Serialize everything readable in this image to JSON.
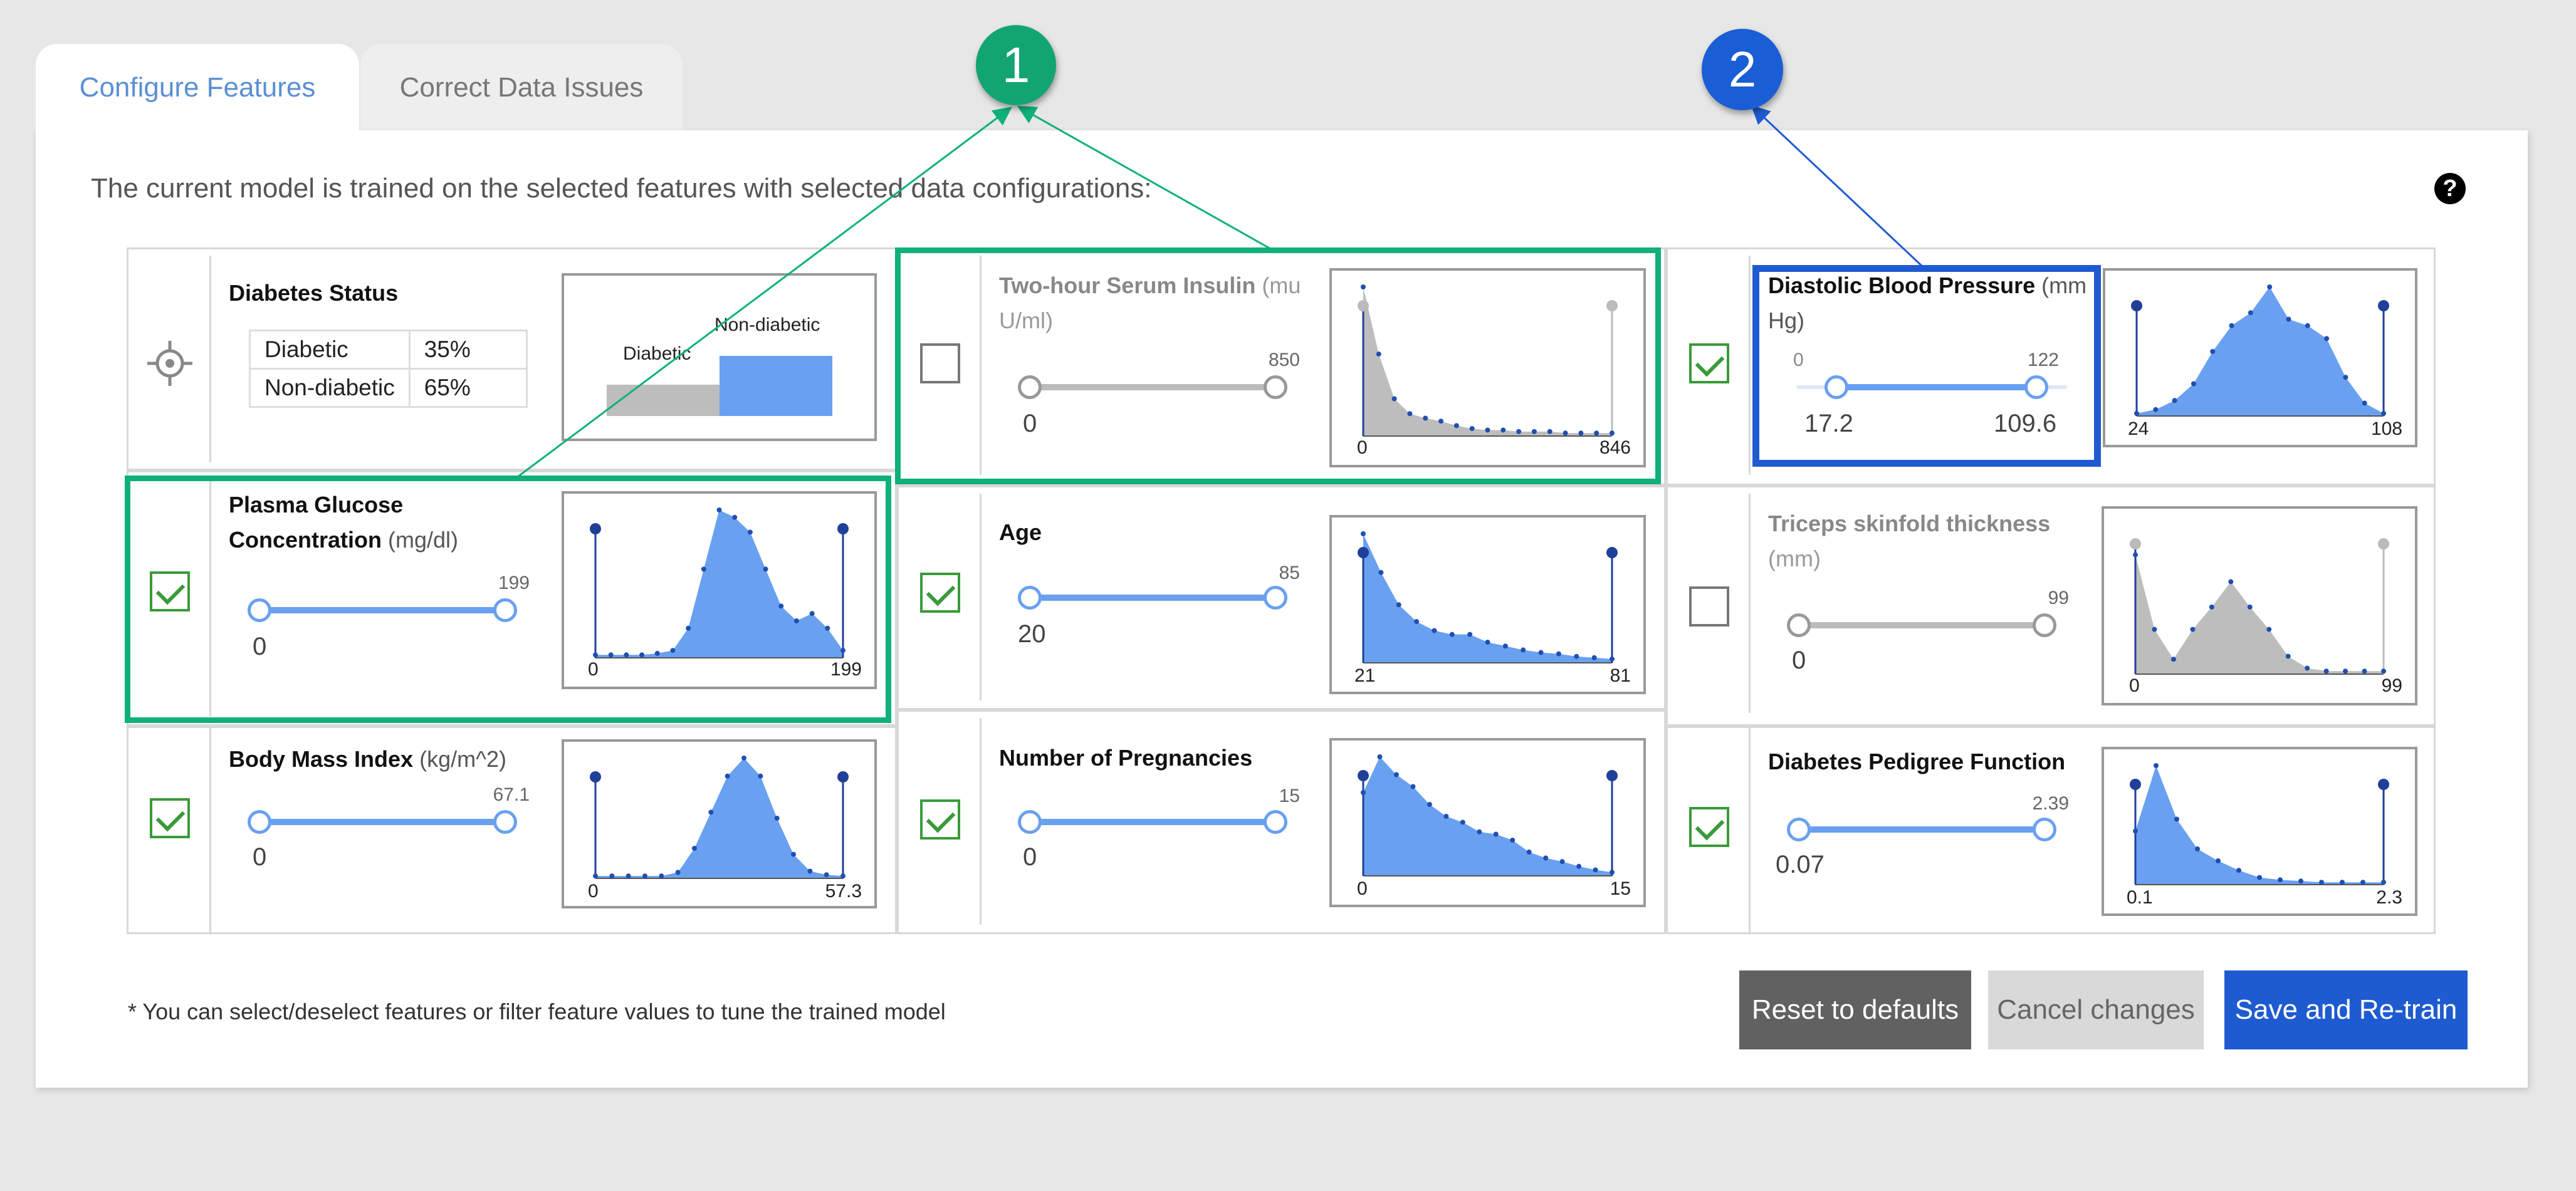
{
  "tabs": [
    {
      "label": "Configure Features",
      "active": true
    },
    {
      "label": "Correct Data Issues",
      "active": false
    }
  ],
  "intro": "The current model is trained on the selected features with selected data configurations:",
  "help_icon": "?",
  "target": {
    "title": "Diabetes Status",
    "rows": [
      {
        "label": "Diabetic",
        "value": "35%"
      },
      {
        "label": "Non-diabetic",
        "value": "65%"
      }
    ],
    "chart_labels": {
      "diabetic": "Diabetic",
      "non_diabetic": "Non-diabetic"
    },
    "shares": {
      "diabetic": 0.35,
      "non_diabetic": 0.65
    }
  },
  "features": {
    "insulin": {
      "name": "Two-hour Serum Insulin",
      "unit": "(mu U/ml)",
      "checked": false,
      "min": "0",
      "max": "850",
      "axis_min": "0",
      "axis_max": "846"
    },
    "bp": {
      "name": "Diastolic Blood Pressure",
      "unit": "(mm Hg)",
      "checked": true,
      "range_min": "0",
      "range_max": "122",
      "min": "17.2",
      "max": "109.6",
      "axis_min": "24",
      "axis_max": "108"
    },
    "glucose": {
      "name": "Plasma Glucose Concentration",
      "unit": "(mg/dl)",
      "checked": true,
      "min": "0",
      "max": "199",
      "axis_min": "0",
      "axis_max": "199"
    },
    "age": {
      "name": "Age",
      "unit": "",
      "checked": true,
      "min": "20",
      "max": "85",
      "axis_min": "21",
      "axis_max": "81"
    },
    "triceps": {
      "name": "Triceps skinfold thickness",
      "unit": "(mm)",
      "checked": false,
      "min": "0",
      "max": "99",
      "axis_min": "0",
      "axis_max": "99"
    },
    "bmi": {
      "name": "Body Mass Index",
      "unit": "(kg/m^2)",
      "checked": true,
      "min": "0",
      "max": "67.1",
      "axis_min": "0",
      "axis_max": "57.3"
    },
    "pregnancies": {
      "name": "Number of Pregnancies",
      "unit": "",
      "checked": true,
      "min": "0",
      "max": "15",
      "axis_min": "0",
      "axis_max": "15"
    },
    "pedigree": {
      "name": "Diabetes Pedigree Function",
      "unit": "",
      "checked": true,
      "min": "0.07",
      "max": "2.39",
      "axis_min": "0.1",
      "axis_max": "2.3"
    }
  },
  "footnote": "* You can select/deselect features or filter feature values to tune the trained model",
  "buttons": {
    "reset": "Reset to defaults",
    "cancel": "Cancel changes",
    "save": "Save and Re-train"
  },
  "badges": [
    "1",
    "2"
  ],
  "colors": {
    "accent": "#6aa0f0",
    "selected_fill": "#6aa0f0",
    "disabled_fill": "#bdbdbd",
    "highlight_green": "#0fb07a",
    "highlight_blue": "#1f5bd0",
    "save_button": "#1f5bd0",
    "reset_button": "#616161"
  },
  "chart_data": [
    {
      "type": "area",
      "feature": "Two-hour Serum Insulin",
      "x_range": [
        "0",
        "846"
      ],
      "values": [
        1.0,
        0.55,
        0.25,
        0.15,
        0.12,
        0.1,
        0.07,
        0.05,
        0.04,
        0.04,
        0.03,
        0.03,
        0.03,
        0.02,
        0.02,
        0.02,
        0.02
      ],
      "color": "#bdbdbd"
    },
    {
      "type": "area",
      "feature": "Diastolic Blood Pressure",
      "x_range": [
        "24",
        "108"
      ],
      "values": [
        0.02,
        0.05,
        0.12,
        0.25,
        0.5,
        0.7,
        0.8,
        1.0,
        0.75,
        0.7,
        0.6,
        0.3,
        0.1,
        0.02
      ],
      "color": "#6aa0f0"
    },
    {
      "type": "area",
      "feature": "Plasma Glucose Concentration",
      "x_range": [
        "0",
        "199"
      ],
      "values": [
        0.02,
        0.02,
        0.02,
        0.02,
        0.03,
        0.05,
        0.2,
        0.6,
        1.0,
        0.95,
        0.85,
        0.6,
        0.35,
        0.25,
        0.3,
        0.2,
        0.05
      ],
      "color": "#6aa0f0"
    },
    {
      "type": "area",
      "feature": "Age",
      "x_range": [
        "21",
        "81"
      ],
      "values": [
        1.0,
        0.7,
        0.45,
        0.32,
        0.25,
        0.22,
        0.22,
        0.16,
        0.13,
        0.1,
        0.08,
        0.07,
        0.05,
        0.04,
        0.03
      ],
      "color": "#6aa0f0"
    },
    {
      "type": "area",
      "feature": "Triceps skinfold thickness",
      "x_range": [
        "0",
        "99"
      ],
      "values": [
        0.8,
        0.3,
        0.1,
        0.3,
        0.45,
        0.62,
        0.45,
        0.3,
        0.12,
        0.04,
        0.02,
        0.02,
        0.02,
        0.02
      ],
      "color": "#bdbdbd"
    },
    {
      "type": "area",
      "feature": "Body Mass Index",
      "x_range": [
        "0",
        "57.3"
      ],
      "values": [
        0.02,
        0.02,
        0.02,
        0.02,
        0.02,
        0.05,
        0.25,
        0.55,
        0.85,
        1.0,
        0.85,
        0.5,
        0.2,
        0.06,
        0.03,
        0.02
      ],
      "color": "#6aa0f0"
    },
    {
      "type": "area",
      "feature": "Number of Pregnancies",
      "x_range": [
        "0",
        "15"
      ],
      "values": [
        0.7,
        1.0,
        0.85,
        0.75,
        0.6,
        0.5,
        0.45,
        0.37,
        0.35,
        0.3,
        0.2,
        0.15,
        0.12,
        0.08,
        0.05,
        0.03
      ],
      "color": "#6aa0f0"
    },
    {
      "type": "area",
      "feature": "Diabetes Pedigree Function",
      "x_range": [
        "0.1",
        "2.3"
      ],
      "values": [
        0.45,
        1.0,
        0.55,
        0.3,
        0.2,
        0.12,
        0.06,
        0.04,
        0.03,
        0.02,
        0.02,
        0.02,
        0.02
      ],
      "color": "#6aa0f0"
    }
  ]
}
